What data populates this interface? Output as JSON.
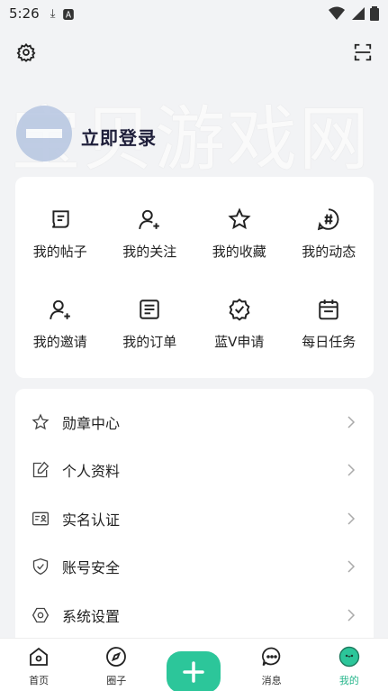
{
  "status_bar": {
    "time": "5:26"
  },
  "watermark": "宝贝游戏网",
  "login": {
    "label": "立即登录"
  },
  "grid": [
    {
      "label": "我的帖子",
      "icon": "posts-icon"
    },
    {
      "label": "我的关注",
      "icon": "follow-icon"
    },
    {
      "label": "我的收藏",
      "icon": "star-icon"
    },
    {
      "label": "我的动态",
      "icon": "hashtag-icon"
    },
    {
      "label": "我的邀请",
      "icon": "invite-icon"
    },
    {
      "label": "我的订单",
      "icon": "order-icon"
    },
    {
      "label": "蓝V申请",
      "icon": "verified-badge-icon"
    },
    {
      "label": "每日任务",
      "icon": "calendar-icon"
    }
  ],
  "menu": [
    {
      "label": "勋章中心",
      "icon": "star-icon"
    },
    {
      "label": "个人资料",
      "icon": "edit-icon"
    },
    {
      "label": "实名认证",
      "icon": "id-card-icon"
    },
    {
      "label": "账号安全",
      "icon": "shield-icon"
    },
    {
      "label": "系统设置",
      "icon": "settings-icon"
    }
  ],
  "nav": [
    {
      "label": "首页",
      "icon": "home-icon"
    },
    {
      "label": "圈子",
      "icon": "compass-icon"
    },
    {
      "label": "",
      "icon": "plus-icon"
    },
    {
      "label": "消息",
      "icon": "message-icon"
    },
    {
      "label": "我的",
      "icon": "profile-icon",
      "active": true
    }
  ],
  "colors": {
    "accent": "#2cc69a",
    "active_text": "#27b68c",
    "background": "#f2f3f5"
  }
}
